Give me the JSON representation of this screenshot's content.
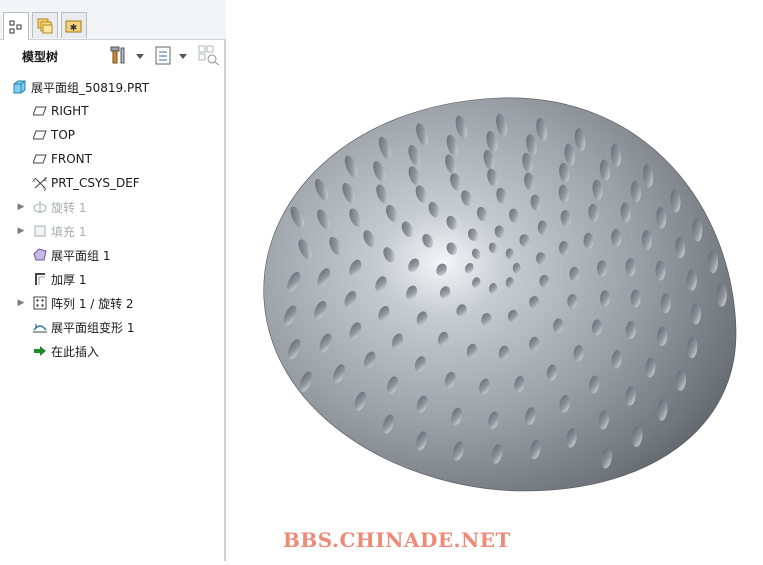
{
  "tabs": [
    {
      "name": "model-tree-tab",
      "icon": "model-tree-icon",
      "active": true
    },
    {
      "name": "folder-browser-tab",
      "icon": "folder-stack-icon",
      "active": false
    },
    {
      "name": "favorites-tab",
      "icon": "favorites-icon",
      "active": false
    }
  ],
  "toolbar": {
    "title": "模型树",
    "settings_icon": "tools-icon",
    "show_icon": "list-icon",
    "filter_icon": "filter-icon"
  },
  "tree": {
    "root": "展平面组_50819.PRT",
    "items": [
      {
        "label": "RIGHT",
        "icon": "datum-plane-icon",
        "expandable": false,
        "dim": false
      },
      {
        "label": "TOP",
        "icon": "datum-plane-icon",
        "expandable": false,
        "dim": false
      },
      {
        "label": "FRONT",
        "icon": "datum-plane-icon",
        "expandable": false,
        "dim": false
      },
      {
        "label": "PRT_CSYS_DEF",
        "icon": "csys-icon",
        "expandable": false,
        "dim": false
      },
      {
        "label": "旋转 1",
        "icon": "revolve-icon",
        "expandable": true,
        "dim": true
      },
      {
        "label": "填充 1",
        "icon": "fill-icon",
        "expandable": true,
        "dim": true
      },
      {
        "label": "展平面组 1",
        "icon": "flatten-quilt-icon",
        "expandable": false,
        "dim": false
      },
      {
        "label": "加厚 1",
        "icon": "thicken-icon",
        "expandable": false,
        "dim": false
      },
      {
        "label": "阵列 1 / 旋转 2",
        "icon": "pattern-icon",
        "expandable": true,
        "dim": false
      },
      {
        "label": "展平面组变形 1",
        "icon": "flatten-deform-icon",
        "expandable": false,
        "dim": false
      },
      {
        "label": "在此插入",
        "icon": "insert-here-arrow-icon",
        "expandable": false,
        "dim": false
      }
    ]
  },
  "viewport": {
    "model": "dimpled-dome-model",
    "color": "#9aa0a6"
  },
  "watermark": "BBS.CHINADE.NET"
}
